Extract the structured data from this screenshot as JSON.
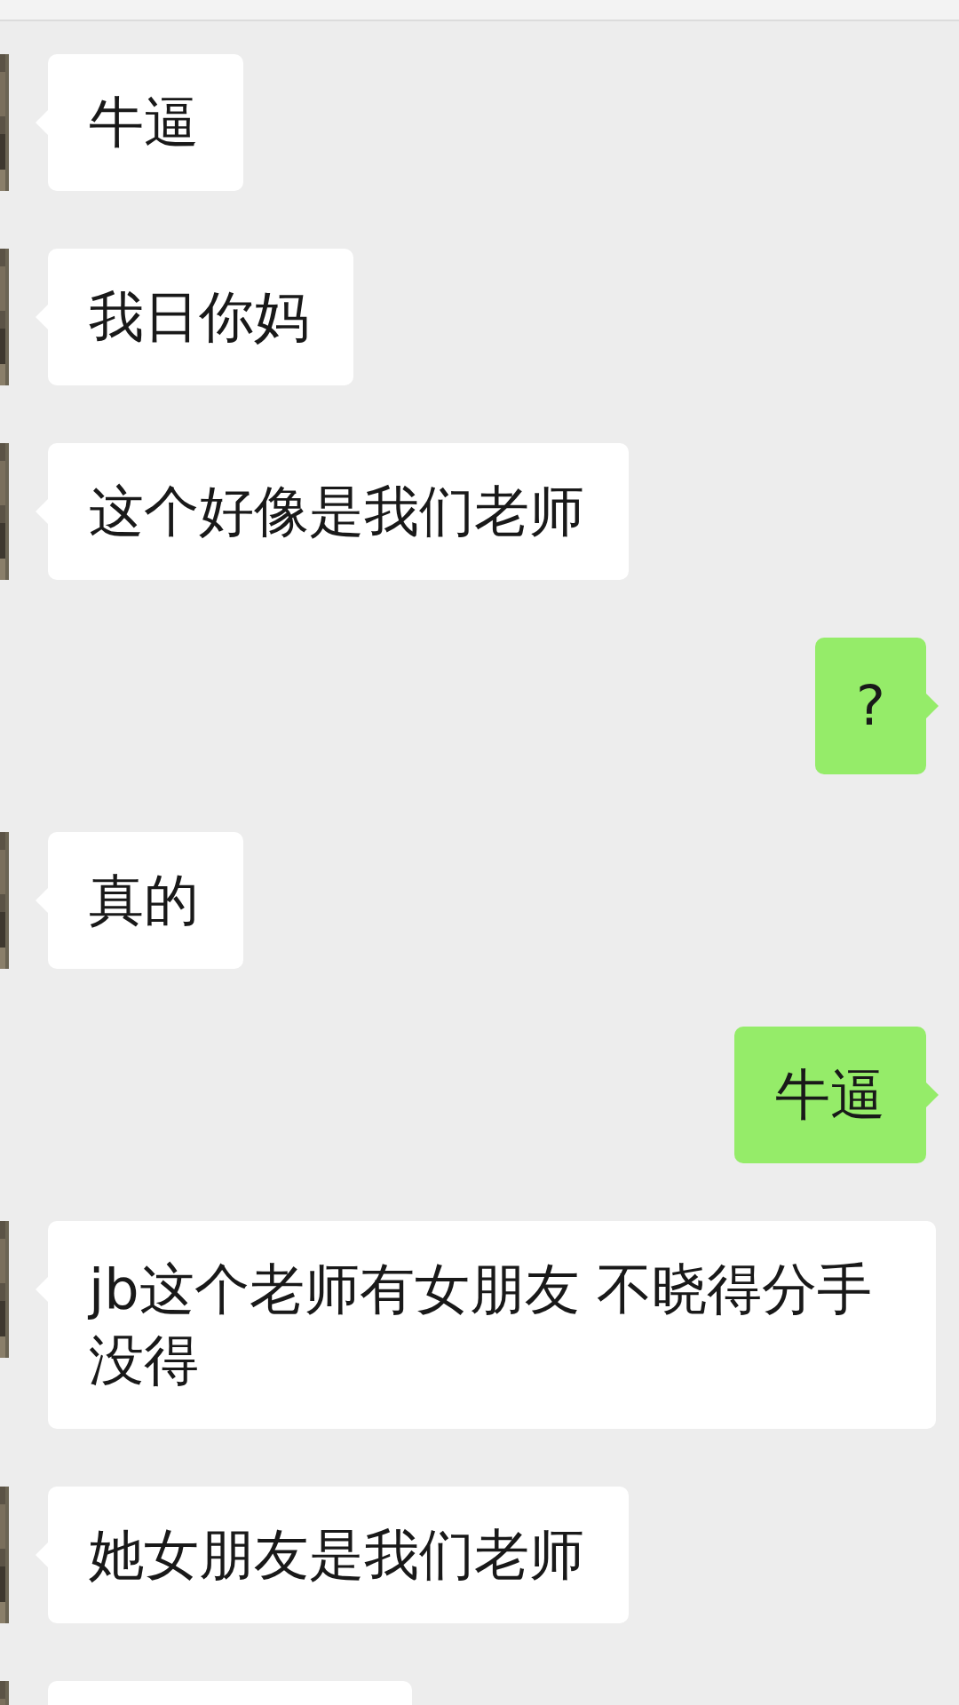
{
  "messages": [
    {
      "kind": "incoming",
      "text": "牛逼"
    },
    {
      "kind": "incoming",
      "text": "我日你妈"
    },
    {
      "kind": "incoming",
      "text": "这个好像是我们老师"
    },
    {
      "kind": "outgoing",
      "text": "?"
    },
    {
      "kind": "incoming",
      "text": "真的"
    },
    {
      "kind": "outgoing",
      "text": "牛逼"
    },
    {
      "kind": "incoming",
      "text": "jb这个老师有女朋友 不晓得分手没得"
    },
    {
      "kind": "incoming",
      "text": "她女朋友是我们老师"
    },
    {
      "kind": "incoming"
    }
  ]
}
